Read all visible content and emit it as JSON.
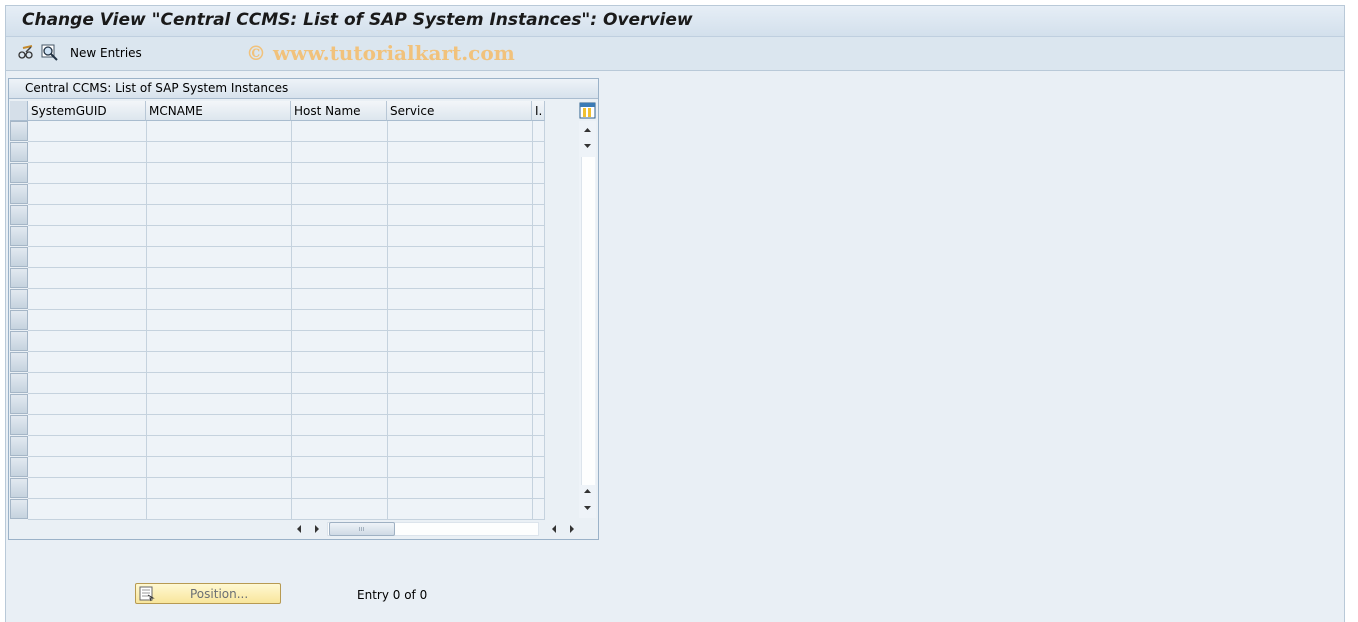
{
  "window": {
    "title": "Change View \"Central CCMS: List of SAP System Instances\": Overview"
  },
  "toolbar": {
    "icons": [
      "glasses-edit-icon",
      "magnifier-details-icon"
    ],
    "new_entries_label": "New Entries",
    "watermark": "© www.tutorialkart.com"
  },
  "table": {
    "title": "Central CCMS: List of SAP System Instances",
    "columns": [
      "SystemGUID",
      "MCNAME",
      "Host Name",
      "Service",
      "I."
    ],
    "visible_row_count": 19,
    "rows": []
  },
  "footer": {
    "position_button_label": "Position...",
    "entry_text": "Entry 0 of 0"
  },
  "colors": {
    "background": "#e9eff5",
    "title_bar": "#d3e0ec",
    "position_button": "#f8e69c",
    "watermark": "#f1c27c"
  }
}
